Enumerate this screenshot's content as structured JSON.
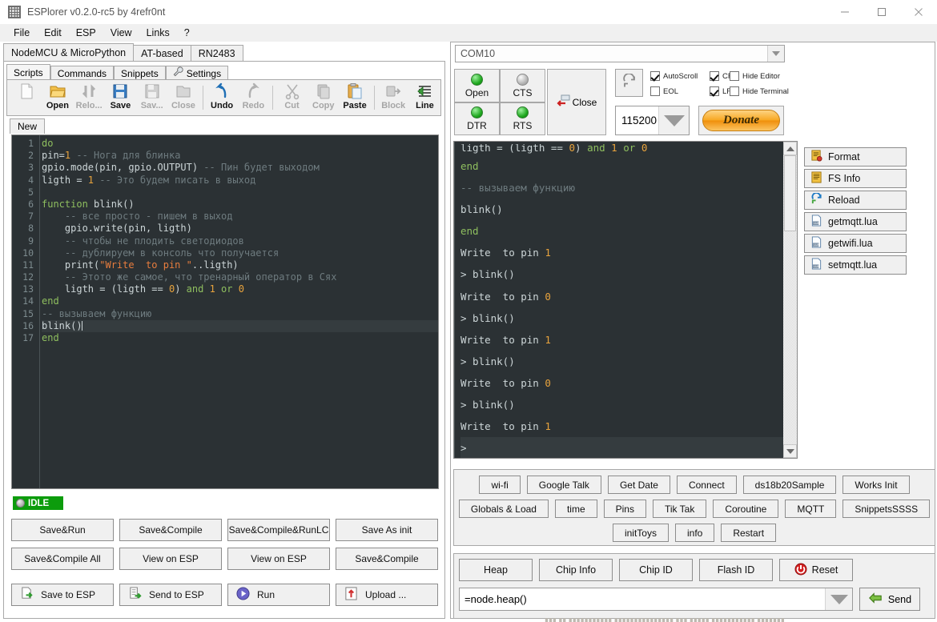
{
  "window": {
    "title": "ESPlorer v0.2.0-rc5 by 4refr0nt",
    "icon": "app-icon",
    "minimize": "–",
    "maximize": "▢",
    "close": "✕"
  },
  "menubar": {
    "items": [
      "File",
      "Edit",
      "ESP",
      "View",
      "Links",
      "?"
    ]
  },
  "main_tabs": [
    {
      "label": "NodeMCU & MicroPython",
      "selected": true
    },
    {
      "label": "AT-based",
      "selected": false
    },
    {
      "label": "RN2483",
      "selected": false
    }
  ],
  "left": {
    "sub_tabs": [
      {
        "label": "Scripts",
        "selected": true,
        "icon": ""
      },
      {
        "label": "Commands",
        "selected": false,
        "icon": ""
      },
      {
        "label": "Snippets",
        "selected": false,
        "icon": ""
      },
      {
        "label": "Settings",
        "selected": false,
        "icon": "wrench-icon"
      }
    ],
    "toolbar": [
      {
        "label": "",
        "icon": "new-file-icon",
        "enabled": true
      },
      {
        "label": "Open",
        "icon": "folder-open-icon",
        "enabled": true
      },
      {
        "label": "Relo...",
        "icon": "reload-icon",
        "enabled": false
      },
      {
        "label": "Save",
        "icon": "floppy-save-icon",
        "enabled": true
      },
      {
        "label": "Sav...",
        "icon": "save-as-icon",
        "enabled": false
      },
      {
        "label": "Close",
        "icon": "close-file-icon",
        "enabled": false
      },
      {
        "label": "Undo",
        "icon": "undo-arrow-icon",
        "enabled": true
      },
      {
        "label": "Redo",
        "icon": "redo-arrow-icon",
        "enabled": false
      },
      {
        "label": "Cut",
        "icon": "scissors-icon",
        "enabled": false
      },
      {
        "label": "Copy",
        "icon": "copy-icon",
        "enabled": false
      },
      {
        "label": "Paste",
        "icon": "clipboard-paste-icon",
        "enabled": true
      },
      {
        "label": "Block",
        "icon": "block-indent-icon",
        "enabled": false
      },
      {
        "label": "Line",
        "icon": "line-indent-icon",
        "enabled": true
      }
    ],
    "file_tabs": [
      {
        "label": "New",
        "selected": true
      }
    ],
    "editor": {
      "current_line": 16,
      "lines": [
        {
          "n": 1,
          "tokens": [
            {
              "t": "do",
              "c": "kw"
            }
          ]
        },
        {
          "n": 2,
          "tokens": [
            {
              "t": "pin=",
              "c": "txt"
            },
            {
              "t": "1",
              "c": "num"
            },
            {
              "t": " ",
              "c": "txt"
            },
            {
              "t": "-- Нога для блинка",
              "c": "cmt"
            }
          ]
        },
        {
          "n": 3,
          "tokens": [
            {
              "t": "gpio.mode(pin, gpio.OUTPUT) ",
              "c": "txt"
            },
            {
              "t": "-- Пин будет выходом",
              "c": "cmt"
            }
          ]
        },
        {
          "n": 4,
          "tokens": [
            {
              "t": "ligth = ",
              "c": "txt"
            },
            {
              "t": "1",
              "c": "num"
            },
            {
              "t": " ",
              "c": "txt"
            },
            {
              "t": "-- Это будем писать в выход",
              "c": "cmt"
            }
          ]
        },
        {
          "n": 5,
          "tokens": []
        },
        {
          "n": 6,
          "tokens": [
            {
              "t": "function",
              "c": "kw"
            },
            {
              "t": " blink()",
              "c": "txt"
            }
          ]
        },
        {
          "n": 7,
          "tokens": [
            {
              "t": "    -- все просто - пишем в выход",
              "c": "cmt"
            }
          ]
        },
        {
          "n": 8,
          "tokens": [
            {
              "t": "    gpio.write(pin, ligth)",
              "c": "txt"
            }
          ]
        },
        {
          "n": 9,
          "tokens": [
            {
              "t": "    -- чтобы не плодить светодиодов",
              "c": "cmt"
            }
          ]
        },
        {
          "n": 10,
          "tokens": [
            {
              "t": "    -- дублируем в консоль что получается",
              "c": "cmt"
            }
          ]
        },
        {
          "n": 11,
          "tokens": [
            {
              "t": "    print(",
              "c": "txt"
            },
            {
              "t": "\"Write  to pin \"",
              "c": "str"
            },
            {
              "t": "..ligth)",
              "c": "txt"
            }
          ]
        },
        {
          "n": 12,
          "tokens": [
            {
              "t": "    -- Этото же самое, что тренарный оператор в Сях",
              "c": "cmt"
            }
          ]
        },
        {
          "n": 13,
          "tokens": [
            {
              "t": "    ligth = (ligth == ",
              "c": "txt"
            },
            {
              "t": "0",
              "c": "num"
            },
            {
              "t": ") ",
              "c": "txt"
            },
            {
              "t": "and",
              "c": "kw"
            },
            {
              "t": " ",
              "c": "txt"
            },
            {
              "t": "1",
              "c": "num"
            },
            {
              "t": " ",
              "c": "txt"
            },
            {
              "t": "or",
              "c": "kw"
            },
            {
              "t": " ",
              "c": "txt"
            },
            {
              "t": "0",
              "c": "num"
            }
          ]
        },
        {
          "n": 14,
          "tokens": [
            {
              "t": "end",
              "c": "kw"
            }
          ]
        },
        {
          "n": 15,
          "tokens": [
            {
              "t": "-- вызываем функцию",
              "c": "cmt"
            }
          ]
        },
        {
          "n": 16,
          "tokens": [
            {
              "t": "blink()",
              "c": "txt"
            }
          ]
        },
        {
          "n": 17,
          "tokens": [
            {
              "t": "end",
              "c": "kw"
            }
          ]
        }
      ]
    },
    "status": {
      "label": "IDLE",
      "color": "#0c9c0c"
    },
    "action_rows": [
      [
        "Save&Run",
        "Save&Compile",
        "Save&Compile&RunLC",
        "Save As init"
      ],
      [
        "Save&Compile All",
        "View on ESP",
        "View on ESP",
        "Save&Compile"
      ]
    ],
    "bottom_buttons": [
      {
        "label": "Save to ESP",
        "icon": "save-to-esp-icon"
      },
      {
        "label": "Send to ESP",
        "icon": "send-to-esp-icon"
      },
      {
        "label": "Run",
        "icon": "run-play-icon"
      },
      {
        "label": "Upload ...",
        "icon": "upload-icon"
      }
    ]
  },
  "right": {
    "com_port": {
      "value": "COM10",
      "icon": "chevron-down-icon"
    },
    "leds": [
      {
        "label": "Open",
        "state": "on"
      },
      {
        "label": "CTS",
        "state": "off"
      },
      {
        "label": "DTR",
        "state": "on"
      },
      {
        "label": "RTS",
        "state": "on"
      }
    ],
    "close_button": {
      "label": "Close",
      "icon": "disconnect-icon"
    },
    "refresh_button": {
      "icon": "refresh-icon"
    },
    "checkboxes": [
      {
        "label": "AutoScroll",
        "checked": true
      },
      {
        "label": "EOL",
        "checked": false
      },
      {
        "label": "CR",
        "checked": true
      },
      {
        "label": "LF",
        "checked": true
      },
      {
        "label": "Hide Editor",
        "checked": false
      },
      {
        "label": "Hide Terminal",
        "checked": false
      }
    ],
    "baud": {
      "value": "115200",
      "icon": "chevron-down-icon"
    },
    "donate": {
      "label": "Donate"
    },
    "terminal": {
      "lines": [
        {
          "text": "ligth = (ligth == 0) and 1 or 0",
          "clipped": true,
          "color": "mixed"
        },
        {
          "text": "end",
          "color": "green"
        },
        {
          "text": "-- вызываем функцию",
          "color": "comment"
        },
        {
          "text": "blink()",
          "color": "plain"
        },
        {
          "text": "end",
          "color": "green"
        },
        {
          "text": "Write  to pin 1",
          "color": "plain-num"
        },
        {
          "text": "> blink()",
          "color": "plain"
        },
        {
          "text": "Write  to pin 0",
          "color": "plain-num"
        },
        {
          "text": "> blink()",
          "color": "plain"
        },
        {
          "text": "Write  to pin 1",
          "color": "plain-num"
        },
        {
          "text": "> blink()",
          "color": "plain"
        },
        {
          "text": "Write  to pin 0",
          "color": "plain-num"
        },
        {
          "text": "> blink()",
          "color": "plain"
        },
        {
          "text": "Write  to pin 1",
          "color": "plain-num"
        },
        {
          "text": "> ",
          "color": "plain",
          "highlight": true
        }
      ]
    },
    "file_buttons": [
      {
        "label": "Format",
        "icon": "format-icon"
      },
      {
        "label": "FS Info",
        "icon": "fs-info-icon"
      },
      {
        "label": "Reload",
        "icon": "reload-circular-icon"
      },
      {
        "label": "getmqtt.lua",
        "icon": "lua-file-icon"
      },
      {
        "label": "getwifi.lua",
        "icon": "lua-file-icon"
      },
      {
        "label": "setmqtt.lua",
        "icon": "lua-file-icon"
      }
    ],
    "snippet_rows": [
      [
        "wi-fi",
        "Google Talk",
        "Get Date",
        "Connect",
        "ds18b20Sample",
        "Works Init"
      ],
      [
        "Globals & Load",
        "time",
        "Pins",
        "Tik Tak",
        "Coroutine",
        "MQTT",
        "SnippetsSSSS"
      ],
      [
        "initToys",
        "info",
        "Restart"
      ]
    ],
    "command_buttons": [
      {
        "label": "Heap",
        "icon": ""
      },
      {
        "label": "Chip Info",
        "icon": ""
      },
      {
        "label": "Chip ID",
        "icon": ""
      },
      {
        "label": "Flash ID",
        "icon": ""
      },
      {
        "label": "Reset",
        "icon": "power-reset-icon"
      }
    ],
    "command_input": {
      "value": "=node.heap()",
      "icon": "chevron-down-icon"
    },
    "send_button": {
      "label": "Send",
      "icon": "send-arrow-icon"
    }
  }
}
